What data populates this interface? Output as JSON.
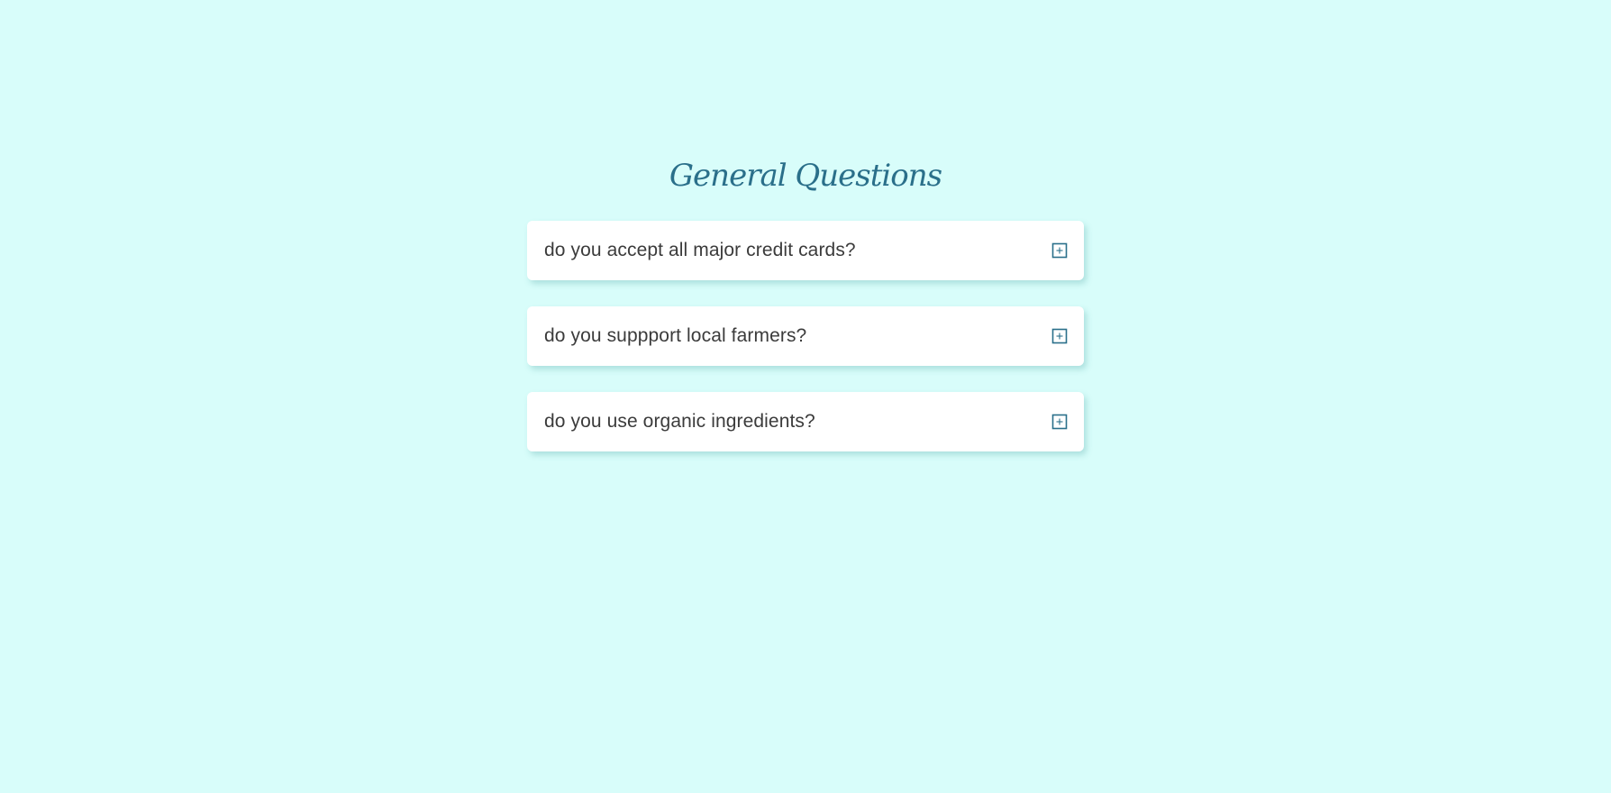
{
  "faq": {
    "title": "General Questions",
    "items": [
      {
        "question": "do you accept all major credit cards?",
        "icon": "plus-square-icon"
      },
      {
        "question": "do you suppport local farmers?",
        "icon": "plus-square-icon"
      },
      {
        "question": "do you use organic ingredients?",
        "icon": "plus-square-icon"
      }
    ]
  },
  "colors": {
    "background": "#d8fdfa",
    "title": "#2a6f8a",
    "card": "#ffffff",
    "question_text": "#3b3b3b",
    "icon": "#2a6f8a"
  }
}
